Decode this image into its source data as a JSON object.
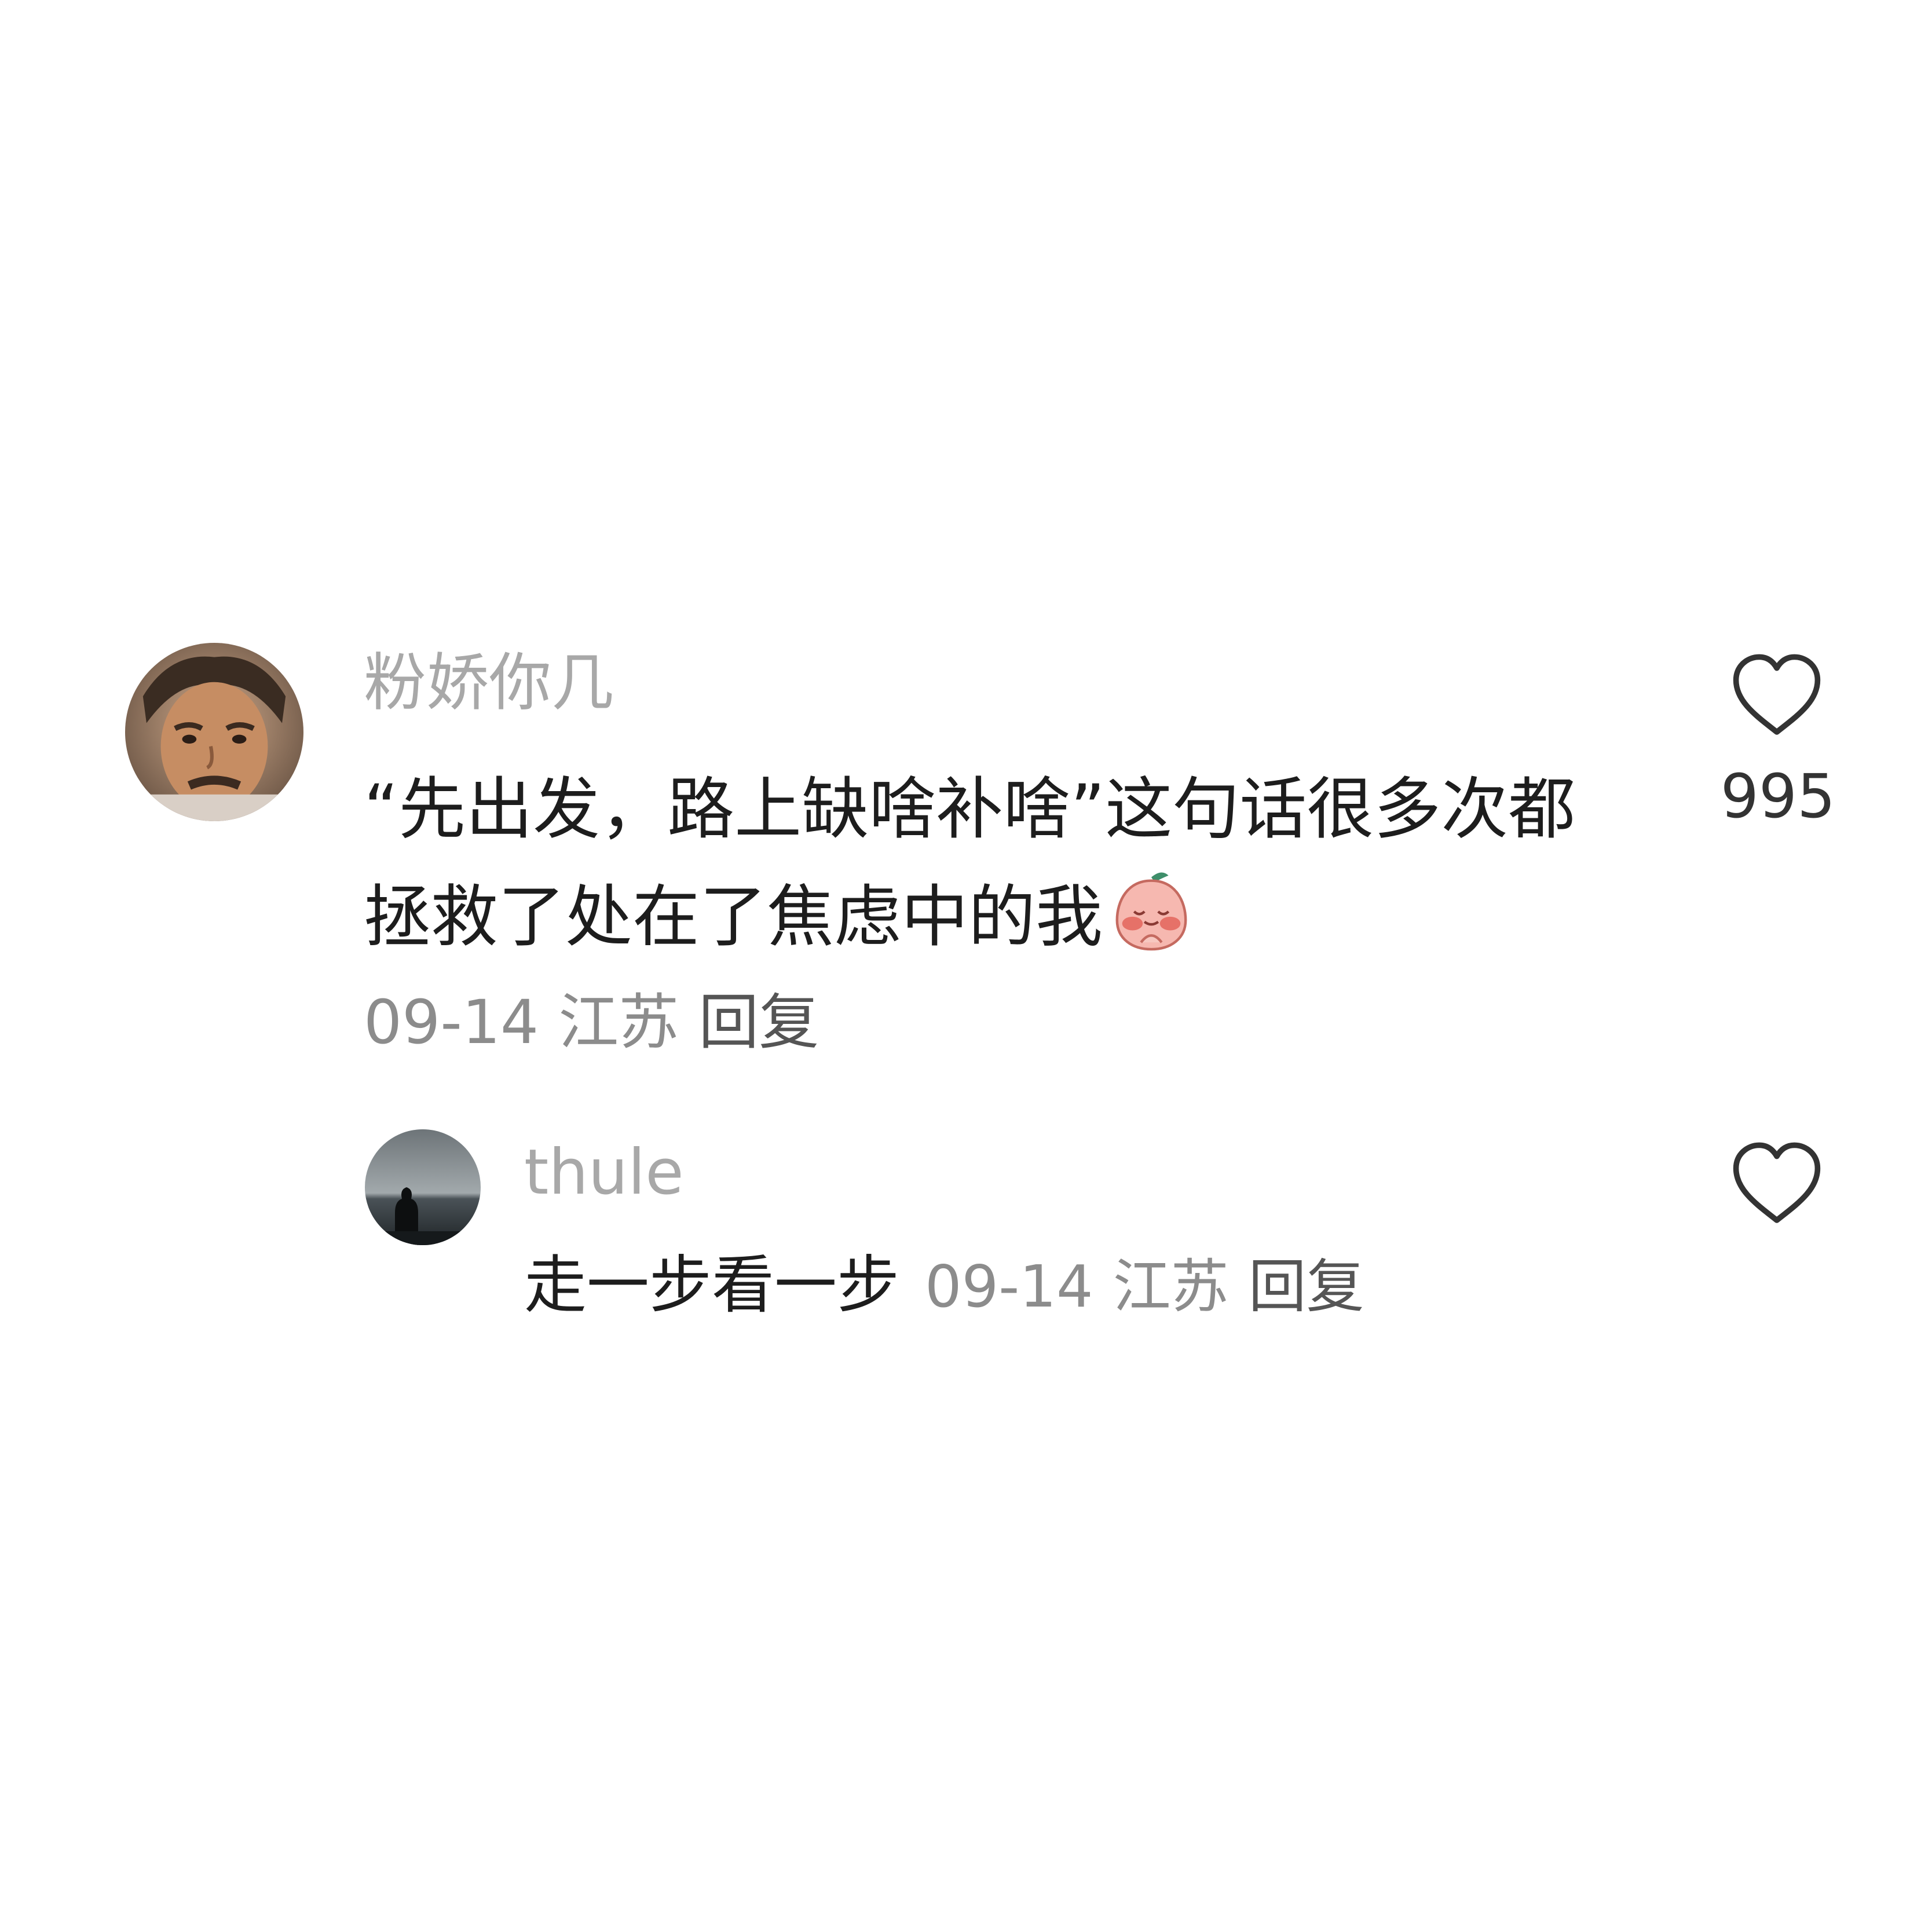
{
  "comment": {
    "username": "粉娇你几",
    "text": "“先出发，路上缺啥补啥”这句话很多次都拯救了处在了焦虑中的我",
    "date": "09-14",
    "location": "江苏",
    "reply_label": "回复",
    "like_count": "995",
    "avatar_icon": "user-avatar-man",
    "emoji_icon": "peach-praying-emoji"
  },
  "reply": {
    "username": "thule",
    "text": "走一步看一步",
    "date": "09-14",
    "location": "江苏",
    "reply_label": "回复",
    "avatar_icon": "user-avatar-silhouette"
  },
  "colors": {
    "background": "#ffffff",
    "username": "#a8a8a8",
    "text": "#1d1d1d",
    "meta": "#8c8c8c",
    "icon": "#333333"
  }
}
